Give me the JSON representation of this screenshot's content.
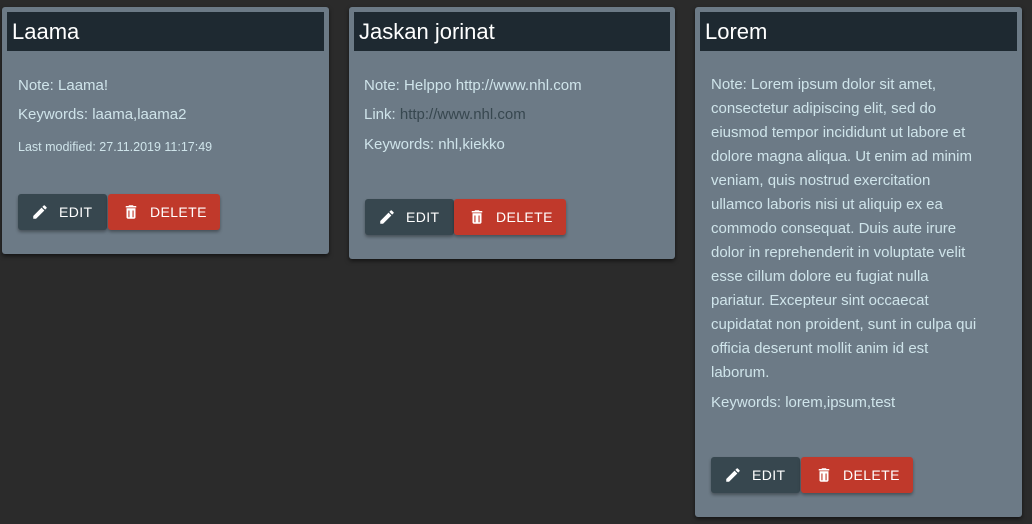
{
  "notes": [
    {
      "title": "Laama",
      "note_line": "Note: Laama!",
      "keywords_line": "Keywords: laama,laama2",
      "modified_line": "Last modified: 27.11.2019 11:17:49",
      "edit_label": "EDIT",
      "delete_label": "DELETE"
    },
    {
      "title": "Jaskan jorinat",
      "note_line": "Note: Helppo http://www.nhl.com",
      "link_prefix": "Link: ",
      "link_url": "http://www.nhl.com",
      "keywords_line": "Keywords: nhl,kiekko",
      "edit_label": "EDIT",
      "delete_label": "DELETE"
    },
    {
      "title": "Lorem",
      "note_lines": [
        "Note: Lorem ipsum dolor sit amet,",
        "consectetur adipiscing elit, sed do",
        "eiusmod tempor incididunt ut labore et",
        "dolore magna aliqua. Ut enim ad minim",
        "veniam, quis nostrud exercitation",
        "ullamco laboris nisi ut aliquip ex ea",
        "commodo consequat. Duis aute irure",
        "dolor in reprehenderit in voluptate velit",
        "esse cillum dolore eu fugiat nulla",
        "pariatur. Excepteur sint occaecat",
        "cupidatat non proident, sunt in culpa qui",
        "officia deserunt mollit anim id est",
        "laborum."
      ],
      "keywords_line": "Keywords: lorem,ipsum,test",
      "edit_label": "EDIT",
      "delete_label": "DELETE"
    }
  ],
  "icons": {
    "edit": "pencil-icon",
    "delete": "trash-icon"
  },
  "colors": {
    "page_background": "#2b2b2b",
    "card_background": "#6c7a86",
    "header_background": "#1e2931",
    "text": "#cfe4ea",
    "link": "#37474f",
    "edit_button": "#37474f",
    "delete_button": "#c0392b"
  }
}
